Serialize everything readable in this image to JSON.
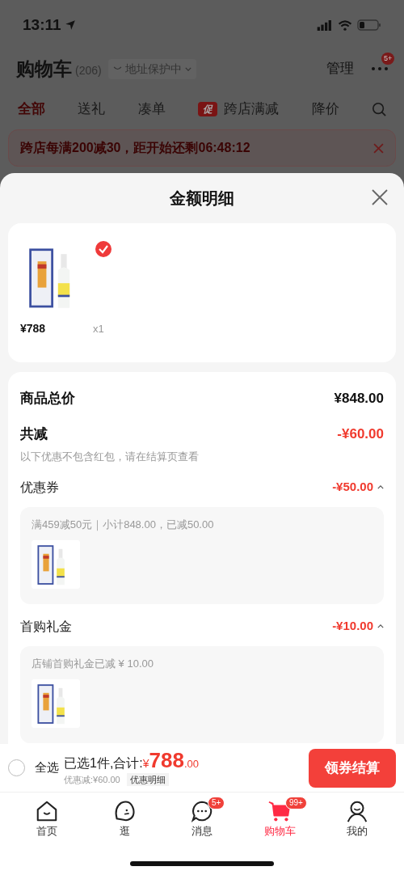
{
  "status_bar": {
    "time": "13:11"
  },
  "header": {
    "title": "购物车",
    "count": "(206)",
    "address_note": "地址保护中",
    "manage": "管理",
    "more_badge": "5+"
  },
  "filter_tabs": [
    {
      "label": "全部",
      "selected": true
    },
    {
      "label": "送礼",
      "selected": false
    },
    {
      "label": "凑单",
      "selected": false
    },
    {
      "label": "跨店满减",
      "selected": false,
      "badge": "促"
    },
    {
      "label": "降价",
      "selected": false
    }
  ],
  "banner": {
    "text": "跨店每满200减30，距开始还剩06:48:12"
  },
  "sheet": {
    "title": "金额明细",
    "products": [
      {
        "price": "¥788",
        "quantity": "x1",
        "checked": true
      }
    ],
    "total": {
      "label": "商品总价",
      "value": "¥848.00"
    },
    "reduction": {
      "label": "共减",
      "value": "-¥60.00",
      "note": "以下优惠不包含红包，请在结算页查看"
    },
    "discounts": [
      {
        "label": "优惠券",
        "value": "-¥50.00",
        "expanded": true,
        "detail": "满459减50元｜小计848.00，已减50.00"
      },
      {
        "label": "首购礼金",
        "value": "-¥10.00",
        "expanded": true,
        "detail": "店铺首购礼金已减 ¥ 10.00"
      }
    ]
  },
  "bottom_bar": {
    "select_all": {
      "label": "全选",
      "checked": false
    },
    "summary": "已选1件,合计:",
    "currency": "¥",
    "amount_integer": "788",
    "amount_decimal": ".00",
    "discount_note": "优惠减:¥60.00",
    "detail_link": "优惠明细",
    "checkout": "领券结算"
  },
  "tab_bar": [
    {
      "label": "首页",
      "selected": false,
      "kind": "home"
    },
    {
      "label": "逛",
      "selected": false,
      "kind": "browse"
    },
    {
      "label": "消息",
      "selected": false,
      "kind": "message",
      "badge": "5+"
    },
    {
      "label": "购物车",
      "selected": true,
      "kind": "cart",
      "badge": "99+"
    },
    {
      "label": "我的",
      "selected": false,
      "kind": "profile"
    }
  ]
}
